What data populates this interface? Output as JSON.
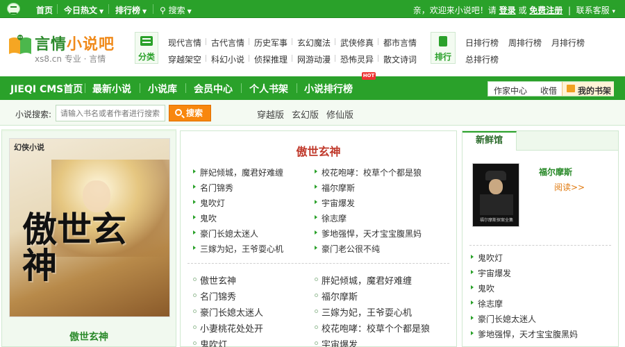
{
  "topbar": {
    "nav": [
      {
        "label": "首页",
        "has_arrow": false
      },
      {
        "label": "今日热文",
        "has_arrow": true
      },
      {
        "label": "排行榜",
        "has_arrow": true
      },
      {
        "label": "搜索",
        "has_arrow": true
      }
    ],
    "welcome": "亲，欢迎来小说吧！请",
    "login": "登录",
    "or": "或",
    "register": "免费注册",
    "service": "联系客服",
    "service_arrow": "▾"
  },
  "logo": {
    "name_a": "言情",
    "name_b": "小说吧",
    "domain": "xs8.cn",
    "slogan": "专业 · 言情"
  },
  "categories": {
    "label": "分类",
    "row1": [
      "现代言情",
      "古代言情",
      "历史军事",
      "玄幻魔法",
      "武侠修真",
      "都市言情"
    ],
    "row2": [
      "穿越架空",
      "科幻小说",
      "侦探推理",
      "网游动漫",
      "恐怖灵异",
      "散文诗词"
    ]
  },
  "rankings": {
    "label": "排行",
    "row1": [
      "日排行榜",
      "周排行榜",
      "月排行榜"
    ],
    "row2": [
      "总排行榜"
    ]
  },
  "mainnav": {
    "items": [
      "JIEQI CMS首页",
      "最新小说",
      "小说库",
      "会员中心",
      "个人书架",
      "小说排行榜"
    ],
    "hot_badge": "HOT",
    "author_center": "作家中心",
    "favorites": "收借",
    "my_shelf": "我的书架"
  },
  "search": {
    "label": "小说搜索:",
    "placeholder": "请输入书名或者作者进行搜索",
    "button": "搜索",
    "hot_keywords": [
      "穿越版",
      "玄幻版",
      "修仙版"
    ]
  },
  "featured": {
    "cover_publisher": "幻侠小说",
    "cover_calligraphy": "傲世玄神",
    "title": "傲世玄神"
  },
  "center": {
    "heading": "傲世玄神",
    "list1_left": [
      "胖妃倾城，魔君好难缠",
      "名门锦秀",
      "鬼吹灯",
      "鬼吹",
      "豪门长媳太迷人",
      "三嫁为妃，王爷耍心机"
    ],
    "list1_right": [
      "校花咆哮：校草个个都是狼",
      "福尔摩斯",
      "宇宙爆发",
      "徐志摩",
      "爹地强悍，天才宝宝腹黑妈",
      "豪门老公很不纯"
    ],
    "list2_left": [
      "傲世玄神",
      "名门锦秀",
      "豪门长媳太迷人",
      "小妻桃花处处开",
      "鬼吹灯"
    ],
    "list2_right": [
      "胖妃倾城，魔君好难缠",
      "福尔摩斯",
      "三嫁为妃，王爷耍心机",
      "校花咆哮：校草个个都是狼",
      "宇宙爆发"
    ]
  },
  "fresh": {
    "heading": "新鲜馆",
    "book_title": "福尔摩斯",
    "read_more": "阅读>>",
    "cover_text": "福尔摩斯探案全集",
    "list": [
      "鬼吹灯",
      "宇宙爆发",
      "鬼吹",
      "徐志摩",
      "豪门长媳太迷人",
      "爹地强悍，天才宝宝腹黑妈"
    ]
  }
}
